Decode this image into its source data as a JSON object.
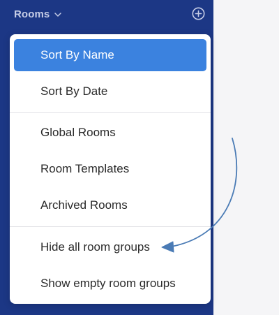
{
  "sidebar": {
    "header": {
      "title": "Rooms",
      "chevron_icon": "chevron-down-icon",
      "add_icon": "add-circle-icon"
    }
  },
  "menu": {
    "items": [
      {
        "label": "Sort By Name",
        "selected": true
      },
      {
        "label": "Sort By Date"
      },
      {
        "label": "Global Rooms"
      },
      {
        "label": "Room Templates"
      },
      {
        "label": "Archived Rooms"
      },
      {
        "label": "Hide all room groups"
      },
      {
        "label": "Show empty room groups"
      }
    ]
  },
  "colors": {
    "sidebar_bg": "#1c3785",
    "selected_bg": "#3b82df",
    "annotation_arrow": "#4a7bb5"
  }
}
